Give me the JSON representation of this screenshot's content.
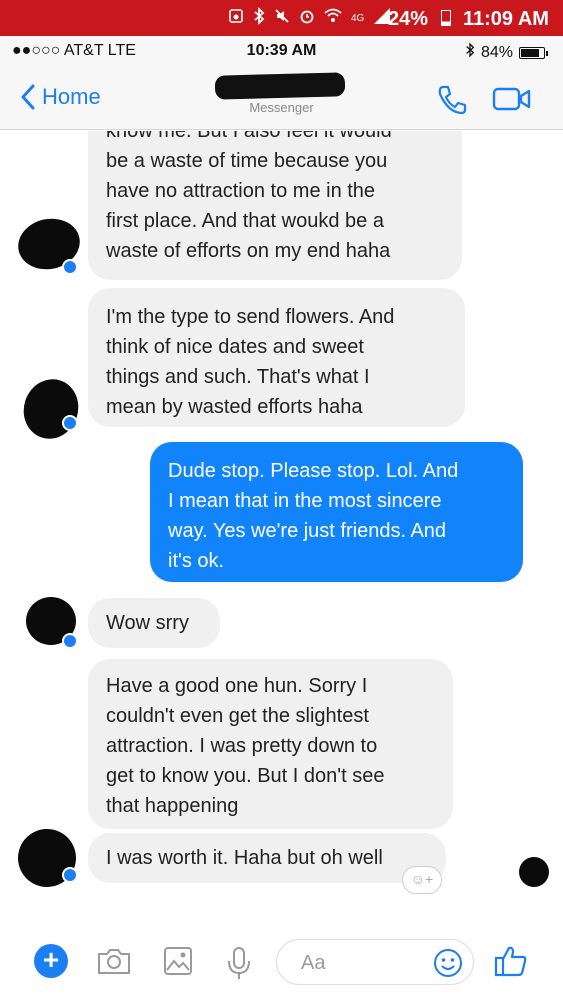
{
  "android_status": {
    "network_label": "4G",
    "battery": "24%",
    "time": "11:09 AM"
  },
  "ios_status": {
    "carrier": "●●○○○ AT&T  LTE",
    "time": "10:39 AM",
    "battery": "84%"
  },
  "nav": {
    "back_label": "Home",
    "subtitle": "Messenger"
  },
  "messages": [
    {
      "direction": "received",
      "lines": [
        "know me. But I also feel it would",
        "be a waste of time because you",
        "have no attraction to me in the",
        "first place. And that woukd be a",
        "waste of efforts on my end haha"
      ]
    },
    {
      "direction": "received",
      "lines": [
        "I'm the type to send flowers. And",
        "think of nice dates and sweet",
        "things and such. That's what I",
        "mean by wasted efforts haha"
      ]
    },
    {
      "direction": "sent",
      "lines": [
        "Dude stop. Please stop. Lol. And",
        "I mean that in the most sincere",
        "way. Yes we're just friends. And",
        "it's ok."
      ]
    },
    {
      "direction": "received",
      "lines": [
        "Wow srry"
      ]
    },
    {
      "direction": "received",
      "lines": [
        "Have a good one hun. Sorry I",
        "couldn't even get the slightest",
        "attraction. I was pretty down to",
        "get to know you. But I don't see",
        "that happening"
      ]
    },
    {
      "direction": "received",
      "lines": [
        "I was worth it. Haha but oh well"
      ]
    }
  ],
  "composer": {
    "placeholder": "Aa"
  },
  "colors": {
    "android_bar": "#c8181e",
    "sent_bubble": "#1184fb",
    "received_bubble": "#f0f0f0",
    "accent": "#1b7ef2"
  },
  "icons": [
    "alarm-icon",
    "bluetooth-icon",
    "mute-icon",
    "wifi-icon",
    "signal-icon",
    "battery-icon",
    "back-chevron-icon",
    "phone-icon",
    "video-icon",
    "plus-icon",
    "camera-icon",
    "gallery-icon",
    "microphone-icon",
    "emoji-icon",
    "thumbs-up-icon",
    "add-reaction-icon"
  ]
}
